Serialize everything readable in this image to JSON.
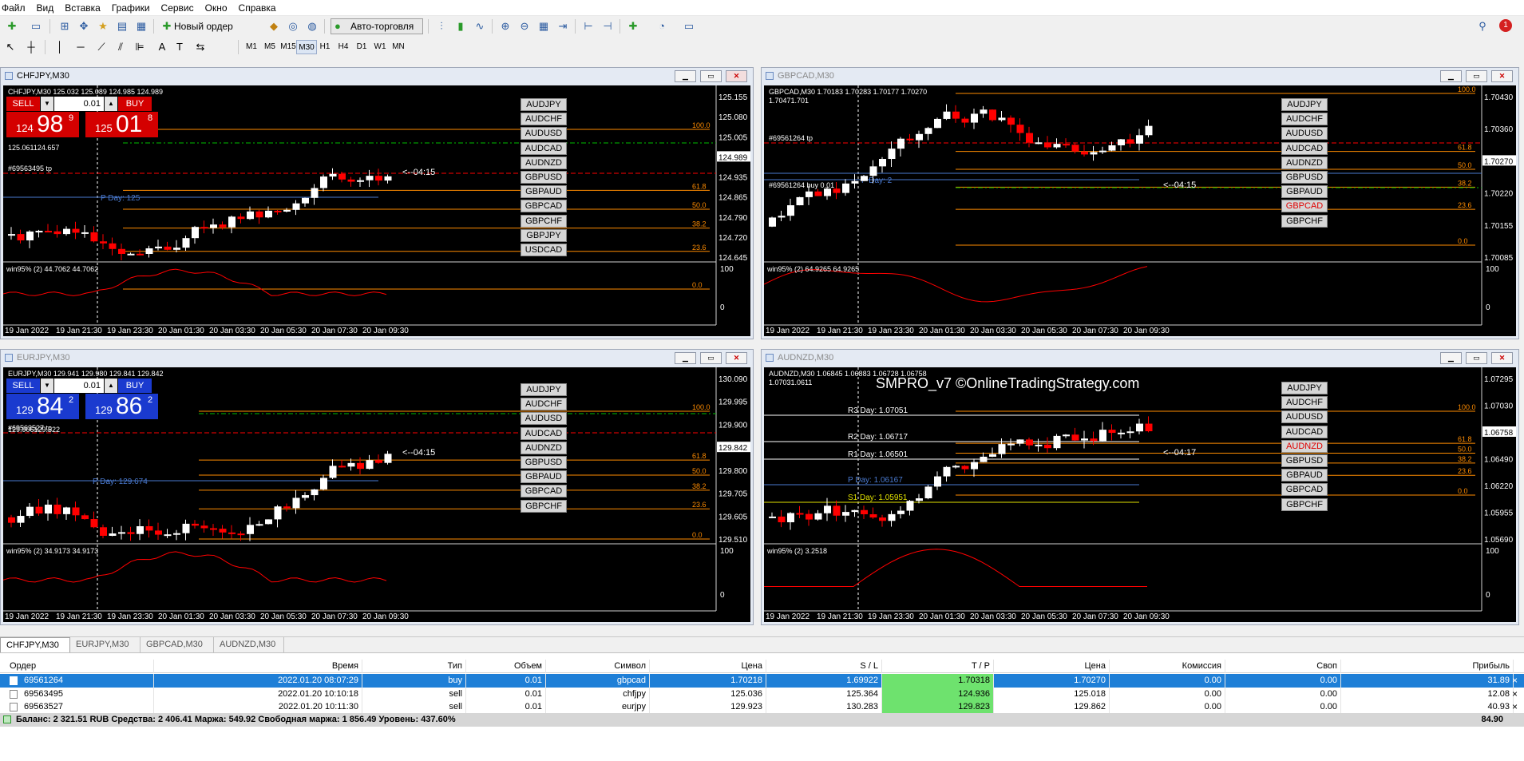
{
  "menu": [
    "Файл",
    "Вид",
    "Вставка",
    "Графики",
    "Сервис",
    "Окно",
    "Справка"
  ],
  "toolbar": {
    "new_order": "Новый ордер",
    "autotrading": "Авто-торговля"
  },
  "timeframes": [
    "M1",
    "M5",
    "M15",
    "M30",
    "H1",
    "H4",
    "D1",
    "W1",
    "MN"
  ],
  "active_timeframe": "M30",
  "colors": {
    "bull": "#ffffff",
    "bear": "#ff0000",
    "fib": "#ff8c00",
    "indicator": "#ff0000",
    "sell": "#d40000",
    "buy_blue": "#1a3acf"
  },
  "charts": [
    {
      "id": "chfjpy",
      "title": "CHFJPY,M30",
      "header": "CHFJPY,M30  125.032 125.089 124.985 124.989",
      "trade": {
        "sell": "SELL",
        "buy": "BUY",
        "volume": "0.01",
        "bid_small": "124",
        "bid_big": "98",
        "bid_sup": "9",
        "ask_small": "125",
        "ask_big": "01",
        "ask_sup": "8",
        "color": "red"
      },
      "line_info": "125.061124.657",
      "tp_label": "#69563495 tp",
      "pday": "P Day: 125",
      "timer": "<--04:15",
      "prices": [
        "125.155",
        "125.080",
        "125.005",
        "124.989",
        "124.935",
        "124.865",
        "124.790",
        "124.720",
        "124.645"
      ],
      "fibs": [
        "100.0",
        "61.8",
        "50.0",
        "38.2",
        "23.6",
        "0.0"
      ],
      "symbols": [
        "AUDJPY",
        "AUDCHF",
        "AUDUSD",
        "AUDCAD",
        "AUDNZD",
        "GBPUSD",
        "GBPAUD",
        "GBPCAD",
        "GBPCHF",
        "GBPJPY",
        "USDCAD"
      ],
      "red_symbol": "",
      "indicator": "win95% (2) 44.7062 44.7062",
      "ind_scale": [
        "100",
        "0"
      ],
      "dates": [
        "19 Jan 2022",
        "19 Jan 21:30",
        "19 Jan 23:30",
        "20 Jan 01:30",
        "20 Jan 03:30",
        "20 Jan 05:30",
        "20 Jan 07:30",
        "20 Jan 09:30"
      ]
    },
    {
      "id": "gbpcad",
      "title": "GBPCAD,M30",
      "header": "GBPCAD,M30  1.70183 1.70283 1.70177 1.70270",
      "line_info": "1.70471.701",
      "tp_label": "#69561264 tp",
      "buy_label": "#69561264 buy 0.01",
      "pday": "P Day: 2",
      "timer": "<--04:15",
      "prices": [
        "1.70430",
        "1.70360",
        "1.70270",
        "1.70220",
        "1.70155",
        "1.70085"
      ],
      "fibs": [
        "100.0",
        "61.8",
        "50.0",
        "38.2",
        "23.6",
        "0.0"
      ],
      "symbols": [
        "AUDJPY",
        "AUDCHF",
        "AUDUSD",
        "AUDCAD",
        "AUDNZD",
        "GBPUSD",
        "GBPAUD",
        "GBPCAD",
        "GBPCHF"
      ],
      "red_symbol": "GBPCAD",
      "indicator": "win95% (2) 64.9265 64.9265",
      "ind_scale": [
        "100",
        "0"
      ],
      "dates": [
        "19 Jan 2022",
        "19 Jan 21:30",
        "19 Jan 23:30",
        "20 Jan 01:30",
        "20 Jan 03:30",
        "20 Jan 05:30",
        "20 Jan 07:30",
        "20 Jan 09:30"
      ]
    },
    {
      "id": "eurjpy",
      "title": "EURJPY,M30",
      "header": "EURJPY,M30  129.941 129.980 129.841 129.842",
      "trade": {
        "sell": "SELL",
        "buy": "BUY",
        "volume": "0.01",
        "bid_small": "129",
        "bid_big": "84",
        "bid_sup": "2",
        "ask_small": "129",
        "ask_big": "86",
        "ask_sup": "2",
        "color": "blue"
      },
      "line_info": "129.906129.522",
      "tp_label": "#69563527 tp",
      "pday": "P Day: 129.674",
      "timer": "<--04:15",
      "prices": [
        "130.090",
        "129.995",
        "129.900",
        "129.842",
        "129.800",
        "129.705",
        "129.605",
        "129.510"
      ],
      "fibs": [
        "100.0",
        "61.8",
        "50.0",
        "38.2",
        "23.6",
        "0.0"
      ],
      "symbols": [
        "AUDJPY",
        "AUDCHF",
        "AUDUSD",
        "AUDCAD",
        "AUDNZD",
        "GBPUSD",
        "GBPAUD",
        "GBPCAD",
        "GBPCHF"
      ],
      "red_symbol": "",
      "indicator": "win95% (2) 34.9173 34.9173",
      "ind_scale": [
        "100",
        "0"
      ],
      "dates": [
        "19 Jan 2022",
        "19 Jan 21:30",
        "19 Jan 23:30",
        "20 Jan 01:30",
        "20 Jan 03:30",
        "20 Jan 05:30",
        "20 Jan 07:30",
        "20 Jan 09:30"
      ]
    },
    {
      "id": "audnzd",
      "title": "AUDNZD,M30",
      "header": "AUDNZD,M30  1.06845 1.06883 1.06728 1.06758",
      "line_info": "1.07031.0611",
      "watermark": "SMPRO_v7 ©OnlineTradingStrategy.com",
      "pivots": [
        "R3 Day: 1.07051",
        "R2 Day: 1.06717",
        "R1 Day: 1.06501",
        "P Day: 1.06167",
        "S1 Day: 1.05951"
      ],
      "timer": "<--04:17",
      "prices": [
        "1.07295",
        "1.07030",
        "1.06758",
        "1.06490",
        "1.06220",
        "1.05955",
        "1.05690"
      ],
      "fibs": [
        "100.0",
        "61.8",
        "50.0",
        "38.2",
        "23.6",
        "0.0"
      ],
      "symbols": [
        "AUDJPY",
        "AUDCHF",
        "AUDUSD",
        "AUDCAD",
        "AUDNZD",
        "GBPUSD",
        "GBPAUD",
        "GBPCAD",
        "GBPCHF"
      ],
      "red_symbol": "AUDNZD",
      "indicator": "win95% (2) 3.2518",
      "ind_scale": [
        "100",
        "0"
      ],
      "dates": [
        "19 Jan 2022",
        "19 Jan 21:30",
        "19 Jan 23:30",
        "20 Jan 01:30",
        "20 Jan 03:30",
        "20 Jan 05:30",
        "20 Jan 07:30",
        "20 Jan 09:30"
      ]
    }
  ],
  "chart_tabs": [
    "CHFJPY,M30",
    "EURJPY,M30",
    "GBPCAD,M30",
    "AUDNZD,M30"
  ],
  "terminal": {
    "columns": [
      "Ордер",
      "Время",
      "Тип",
      "Объем",
      "Символ",
      "Цена",
      "S / L",
      "T / P",
      "Цена",
      "Комиссия",
      "Своп",
      "Прибыль"
    ],
    "rows": [
      {
        "order": "69561264",
        "time": "2022.01.20 08:07:29",
        "type": "buy",
        "volume": "0.01",
        "symbol": "gbpcad",
        "price": "1.70218",
        "sl": "1.69922",
        "tp": "1.70318",
        "cur": "1.70270",
        "commission": "0.00",
        "swap": "0.00",
        "profit": "31.89"
      },
      {
        "order": "69563495",
        "time": "2022.01.20 10:10:18",
        "type": "sell",
        "volume": "0.01",
        "symbol": "chfjpy",
        "price": "125.036",
        "sl": "125.364",
        "tp": "124.936",
        "cur": "125.018",
        "commission": "0.00",
        "swap": "0.00",
        "profit": "12.08"
      },
      {
        "order": "69563527",
        "time": "2022.01.20 10:11:30",
        "type": "sell",
        "volume": "0.01",
        "symbol": "eurjpy",
        "price": "129.923",
        "sl": "130.283",
        "tp": "129.823",
        "cur": "129.862",
        "commission": "0.00",
        "swap": "0.00",
        "profit": "40.93"
      }
    ],
    "summary": "Баланс: 2 321.51 RUB  Средства: 2 406.41  Маржа: 549.92  Свободная маржа: 1 856.49  Уровень: 437.60%",
    "total_profit": "84.90"
  }
}
